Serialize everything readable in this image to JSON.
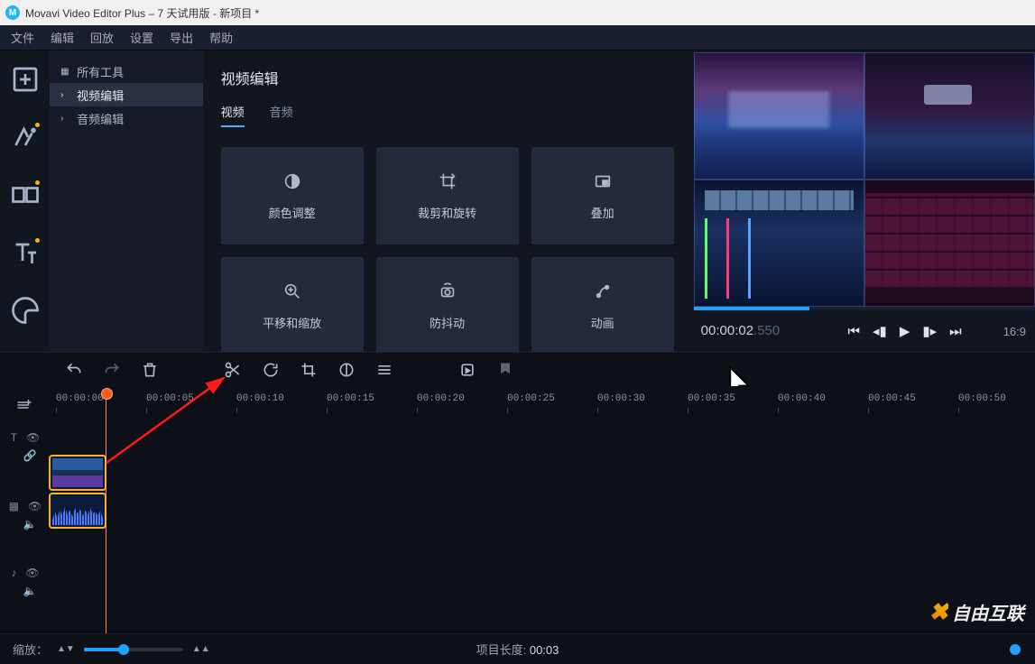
{
  "titlebar": {
    "text": "Movavi Video Editor Plus – 7 天试用版 - 新项目 *"
  },
  "menu": [
    "文件",
    "编辑",
    "回放",
    "设置",
    "导出",
    "帮助"
  ],
  "categories": {
    "header": "所有工具",
    "items": [
      {
        "label": "视频编辑",
        "selected": true
      },
      {
        "label": "音频编辑",
        "selected": false
      }
    ]
  },
  "tools_panel": {
    "title": "视频编辑",
    "tabs": [
      {
        "label": "视频",
        "active": true
      },
      {
        "label": "音频",
        "active": false
      }
    ],
    "cards": [
      {
        "id": "color-adjust",
        "label": "颜色调整"
      },
      {
        "id": "crop-rotate",
        "label": "裁剪和旋转"
      },
      {
        "id": "overlay",
        "label": "叠加"
      },
      {
        "id": "pan-zoom",
        "label": "平移和缩放"
      },
      {
        "id": "stabilize",
        "label": "防抖动"
      },
      {
        "id": "animation",
        "label": "动画"
      }
    ]
  },
  "preview": {
    "timecode_main": "00:00:02",
    "timecode_ms": ".550",
    "duration": "16:9"
  },
  "ruler_ticks": [
    "00:00:00",
    "00:00:05",
    "00:00:10",
    "00:00:15",
    "00:00:20",
    "00:00:25",
    "00:00:30",
    "00:00:35",
    "00:00:40",
    "00:00:45",
    "00:00:50"
  ],
  "playhead_tick_index": 0.55,
  "bottom": {
    "zoom_label": "缩放：",
    "project_len_label": "项目长度:",
    "project_len_value": "00:03"
  },
  "zoom_percent": 40,
  "watermark": "自由互联"
}
